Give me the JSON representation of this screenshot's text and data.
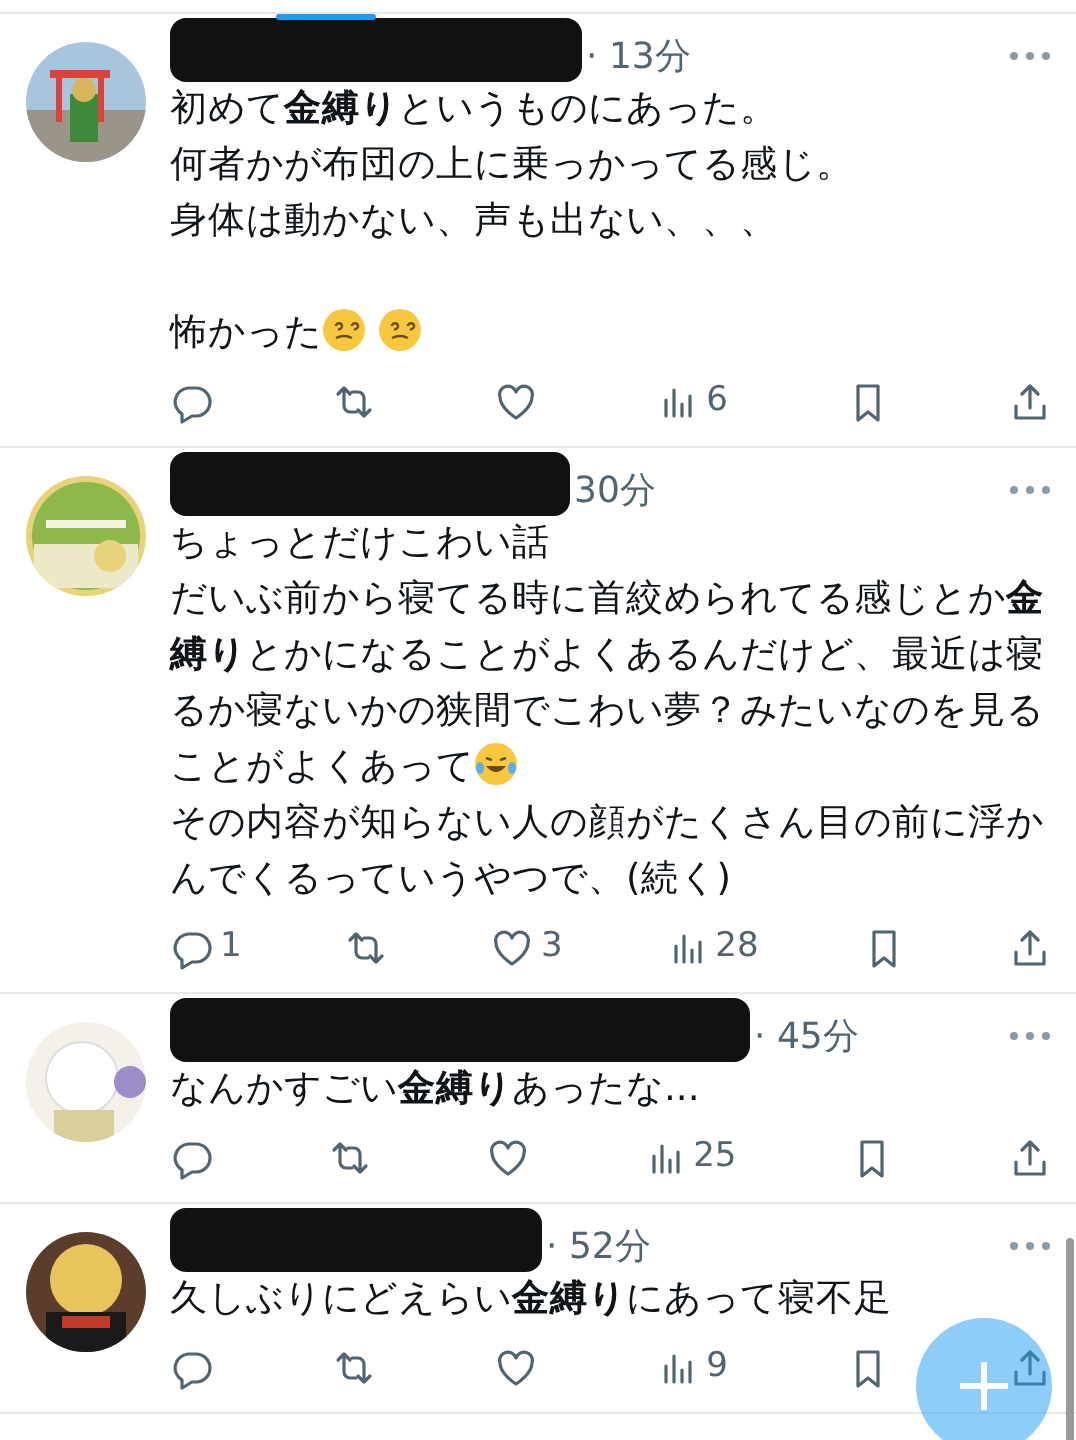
{
  "tweets": [
    {
      "time": "· 13分",
      "lines": [
        {
          "parts": [
            {
              "kind": "text",
              "text": "初めて**金縛り**というものにあった。"
            }
          ]
        },
        {
          "parts": [
            {
              "kind": "text",
              "text": "何者かが布団の上に乗っかってる感じ。"
            }
          ]
        },
        {
          "parts": [
            {
              "kind": "text",
              "text": "身体は動かない、声も出ない、、、"
            }
          ]
        },
        {
          "kind": "blank"
        },
        {
          "parts": [
            {
              "kind": "text",
              "text": "怖かった"
            },
            {
              "kind": "dizzy"
            },
            {
              "kind": "dizzy"
            }
          ]
        }
      ],
      "actions": [
        {
          "kind": "reply"
        },
        {
          "kind": "retweet"
        },
        {
          "kind": "like"
        },
        {
          "kind": "views",
          "count": "6"
        },
        {
          "kind": "bookmark"
        },
        {
          "kind": "share"
        }
      ]
    },
    {
      "time": "30分",
      "lines": [
        {
          "parts": [
            {
              "kind": "text",
              "text": "ちょっとだけこわい話"
            }
          ]
        },
        {
          "parts": [
            {
              "kind": "text",
              "text": "だいぶ前から寝てる時に首絞められてる感じとか**金縛り**とかになることがよくあるんだけど、最近は寝るか寝ないかの狭間でこわい夢？みたいなのを見ることがよくあって"
            },
            {
              "kind": "laughing"
            }
          ]
        },
        {
          "parts": [
            {
              "kind": "text",
              "text": "その内容が知らない人の顔がたくさん目の前に浮かんでくるっていうやつで、(続く)"
            }
          ]
        }
      ],
      "actions": [
        {
          "kind": "reply",
          "count": "1"
        },
        {
          "kind": "retweet"
        },
        {
          "kind": "like",
          "count": "3"
        },
        {
          "kind": "views",
          "count": "28"
        },
        {
          "kind": "bookmark"
        },
        {
          "kind": "share"
        }
      ]
    },
    {
      "time": "· 45分",
      "lines": [
        {
          "parts": [
            {
              "kind": "text",
              "text": "なんかすごい**金縛り**あったな..."
            }
          ]
        }
      ],
      "actions": [
        {
          "kind": "reply"
        },
        {
          "kind": "retweet"
        },
        {
          "kind": "like"
        },
        {
          "kind": "views",
          "count": "25"
        },
        {
          "kind": "bookmark"
        },
        {
          "kind": "share"
        }
      ]
    },
    {
      "time": "· 52分",
      "lines": [
        {
          "parts": [
            {
              "kind": "text",
              "text": "久しぶりにどえらい**金縛り**にあって寝不足"
            }
          ]
        }
      ],
      "actions": [
        {
          "kind": "reply"
        },
        {
          "kind": "retweet"
        },
        {
          "kind": "like"
        },
        {
          "kind": "views",
          "count": "9"
        },
        {
          "kind": "bookmark"
        },
        {
          "kind": "share"
        }
      ]
    }
  ]
}
